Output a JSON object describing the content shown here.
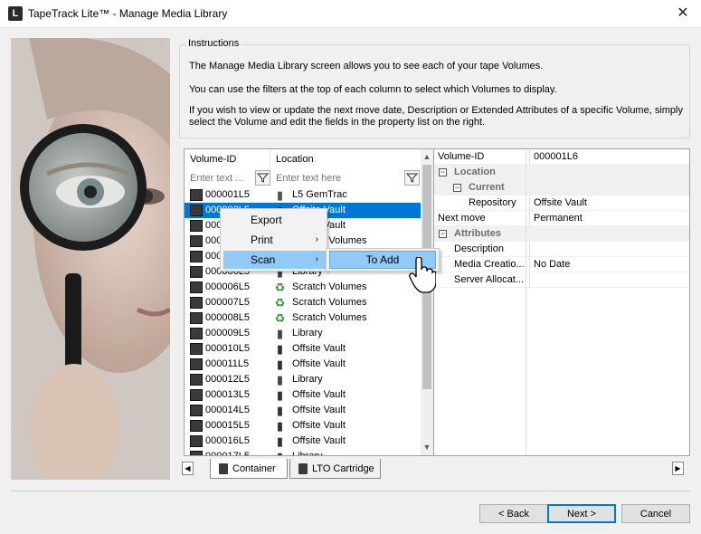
{
  "window": {
    "title": "TapeTrack Lite™ - Manage Media Library",
    "close_glyph": "✕",
    "icon_letter": "L"
  },
  "instructions": {
    "heading": "Instructions",
    "p1": "The Manage Media Library screen allows you to see each of your tape Volumes.",
    "p2": "You can use the filters at the top of each column to select which Volumes to display.",
    "p3a": "If you wish to view or update the next move date, Description or Extended Attributes of a specific Volume, simply",
    "p3b": "select the Volume and edit the fields in the property list on the right."
  },
  "grid": {
    "columns": {
      "volume_id": "Volume-ID",
      "location": "Location"
    },
    "filter_placeholders": {
      "volume_id": "Enter text ...",
      "location": "Enter text here"
    },
    "rows": [
      {
        "id": "000001L5",
        "location": "L5 GemTrac",
        "icon": "library-gem-icon",
        "selected": false
      },
      {
        "id": "000002L5",
        "location": "Offsite Vault",
        "icon": "vault-icon",
        "selected": true
      },
      {
        "id": "000003L5",
        "location": "Offsite Vault",
        "icon": "vault-icon",
        "selected": false
      },
      {
        "id": "000004L5",
        "location": "Scratch Volumes",
        "icon": "recycle-icon",
        "selected": false
      },
      {
        "id": "000005L5",
        "location": "Library",
        "icon": "library-icon",
        "selected": false
      },
      {
        "id": "000006L5",
        "location": "Library",
        "icon": "library-icon",
        "selected": false
      },
      {
        "id": "000006L5",
        "location": "Scratch Volumes",
        "icon": "recycle-icon",
        "selected": false
      },
      {
        "id": "000007L5",
        "location": "Scratch Volumes",
        "icon": "recycle-icon",
        "selected": false
      },
      {
        "id": "000008L5",
        "location": "Scratch Volumes",
        "icon": "recycle-icon",
        "selected": false
      },
      {
        "id": "000009L5",
        "location": "Library",
        "icon": "library-icon",
        "selected": false
      },
      {
        "id": "000010L5",
        "location": "Offsite Vault",
        "icon": "vault-icon",
        "selected": false
      },
      {
        "id": "000011L5",
        "location": "Offsite Vault",
        "icon": "vault-icon",
        "selected": false
      },
      {
        "id": "000012L5",
        "location": "Library",
        "icon": "library-icon",
        "selected": false
      },
      {
        "id": "000013L5",
        "location": "Offsite Vault",
        "icon": "vault-icon",
        "selected": false
      },
      {
        "id": "000014L5",
        "location": "Offsite Vault",
        "icon": "vault-icon",
        "selected": false
      },
      {
        "id": "000015L5",
        "location": "Offsite Vault",
        "icon": "vault-icon",
        "selected": false
      },
      {
        "id": "000016L5",
        "location": "Offsite Vault",
        "icon": "vault-icon",
        "selected": false
      },
      {
        "id": "000017L5",
        "location": "Library",
        "icon": "library-icon",
        "selected": false
      }
    ]
  },
  "properties": {
    "volume_id_label": "Volume-ID",
    "volume_id_value": "000001L6",
    "cat_location": "Location",
    "cat_current": "Current",
    "repository_label": "Repository",
    "repository_value": "Offsite Vault",
    "next_move_label": "Next move",
    "next_move_value": "Permanent",
    "cat_attributes": "Attributes",
    "description_label": "Description",
    "description_value": "",
    "media_creation_label": "Media Creatio...",
    "media_creation_value": "No Date",
    "server_alloc_label": "Server Allocat...",
    "server_alloc_value": "",
    "collapse_glyph": "−"
  },
  "tabs": [
    {
      "label": "Container",
      "active": true
    },
    {
      "label": "LTO Cartridge",
      "active": false
    }
  ],
  "tab_scroll": {
    "left": "◀",
    "right": "▶"
  },
  "buttons": {
    "back": "< Back",
    "next": "Next >",
    "cancel": "Cancel"
  },
  "context_menu": {
    "items": [
      {
        "label": "Export",
        "submenu": false
      },
      {
        "label": "Print",
        "submenu": true
      },
      {
        "label": "Scan",
        "submenu": true,
        "highlighted": true
      }
    ],
    "arrow_glyph": "›",
    "submenu_item": "To Add"
  },
  "colors": {
    "selection": "#0078d7",
    "menu_highlight": "#91c9f7",
    "window_bg": "#f0f0f0"
  }
}
